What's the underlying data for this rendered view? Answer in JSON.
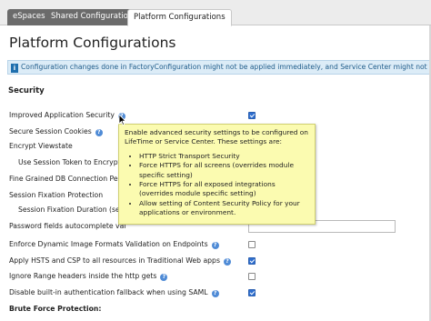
{
  "tabs": [
    {
      "label": "eSpaces",
      "active": false
    },
    {
      "label": "Shared Configurations",
      "active": false
    },
    {
      "label": "Platform Configurations",
      "active": true
    }
  ],
  "page_title": "Platform Configurations",
  "info_message": "Configuration changes done in FactoryConfiguration might not be applied immediately, and Service Center might not show ar",
  "section_title": "Security",
  "rows": [
    {
      "label": "Improved Application Security",
      "help": true,
      "control": "checkbox",
      "checked": true
    },
    {
      "label": "Secure Session Cookies",
      "help": true,
      "control": "none"
    },
    {
      "label": "Encrypt Viewstate",
      "help": false,
      "control": "none"
    },
    {
      "label": "Use Session Token to Encrypt V",
      "help": false,
      "control": "none",
      "indent": true
    },
    {
      "label": "Fine Grained DB Connection Perm",
      "help": false,
      "control": "none"
    },
    {
      "label": "Session Fixation Protection",
      "help": false,
      "control": "none"
    },
    {
      "label": "Session Fixation Duration (seco",
      "help": false,
      "control": "none",
      "indent": true
    },
    {
      "label": "Password fields autocomplete val",
      "help": false,
      "control": "text"
    },
    {
      "label": "Enforce Dynamic Image Formats Validation on Endpoints",
      "help": true,
      "control": "checkbox",
      "checked": false
    },
    {
      "label": "Apply HSTS and CSP to all resources in Traditional Web apps",
      "help": true,
      "control": "checkbox",
      "checked": true
    },
    {
      "label": "Ignore Range headers inside the http gets",
      "help": true,
      "control": "checkbox",
      "checked": false
    },
    {
      "label": "Disable built-in authentication fallback when using SAML",
      "help": true,
      "control": "checkbox",
      "checked": true
    },
    {
      "label": "Brute Force Protection:",
      "help": false,
      "control": "none",
      "bold": true
    }
  ],
  "tooltip": {
    "intro": "Enable advanced security settings to be configured on LifeTime or Service Center. These settings are:",
    "items": [
      "HTTP Strict Transport Security",
      "Force HTTPS for all screens (overrides module specific setting)",
      "Force HTTPS for all exposed integrations (overrides module specific setting)",
      "Allow setting of Content Security Policy for your applications or environment."
    ]
  },
  "icons": {
    "info": "info-icon",
    "help": "question-circle-icon",
    "cursor": "mouse-pointer-icon"
  },
  "colors": {
    "accent": "#2f6fcf",
    "info_bg": "#dcecf7",
    "tooltip_bg": "#fbfbb0",
    "tab_inactive": "#6b6b6b"
  }
}
